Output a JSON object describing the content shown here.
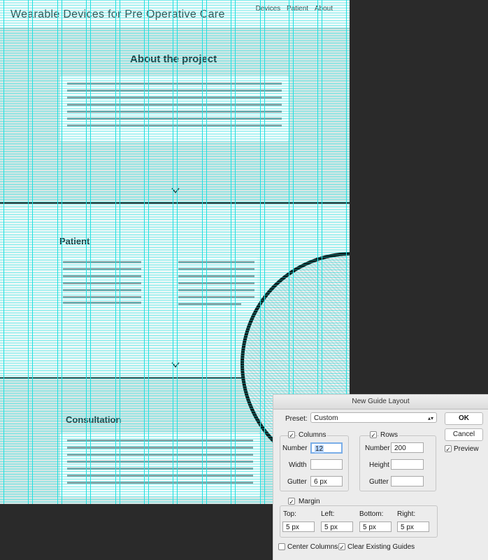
{
  "canvas": {
    "site_title": "Wearable Devices for Pre Operative Care",
    "nav": [
      "Devices",
      "Patient",
      "About"
    ],
    "sections": {
      "about": "About the project",
      "patient": "Patient",
      "consultation": "Consultation"
    }
  },
  "dialog": {
    "title": "New Guide Layout",
    "preset_label": "Preset:",
    "preset_value": "Custom",
    "ok": "OK",
    "cancel": "Cancel",
    "preview": "Preview",
    "columns": {
      "label": "Columns",
      "number_label": "Number",
      "number": "12",
      "width_label": "Width",
      "width": "",
      "gutter_label": "Gutter",
      "gutter": "6 px"
    },
    "rows": {
      "label": "Rows",
      "number_label": "Number",
      "number": "200",
      "height_label": "Height",
      "height": "",
      "gutter_label": "Gutter",
      "gutter": ""
    },
    "margin": {
      "label": "Margin",
      "top_label": "Top:",
      "top": "5 px",
      "left_label": "Left:",
      "left": "5 px",
      "bottom_label": "Bottom:",
      "bottom": "5 px",
      "right_label": "Right:",
      "right": "5 px"
    },
    "center_columns": "Center Columns",
    "clear_guides": "Clear Existing Guides"
  },
  "colors": {
    "guide": "#22e0e0",
    "dark_band_bg": "#d3e7e5",
    "light_band_bg": "#ecf8f7",
    "focus_ring": "#7aaee8"
  },
  "icons": [
    "chevron-down-icon",
    "checkmark-icon",
    "select-arrows-icon"
  ]
}
